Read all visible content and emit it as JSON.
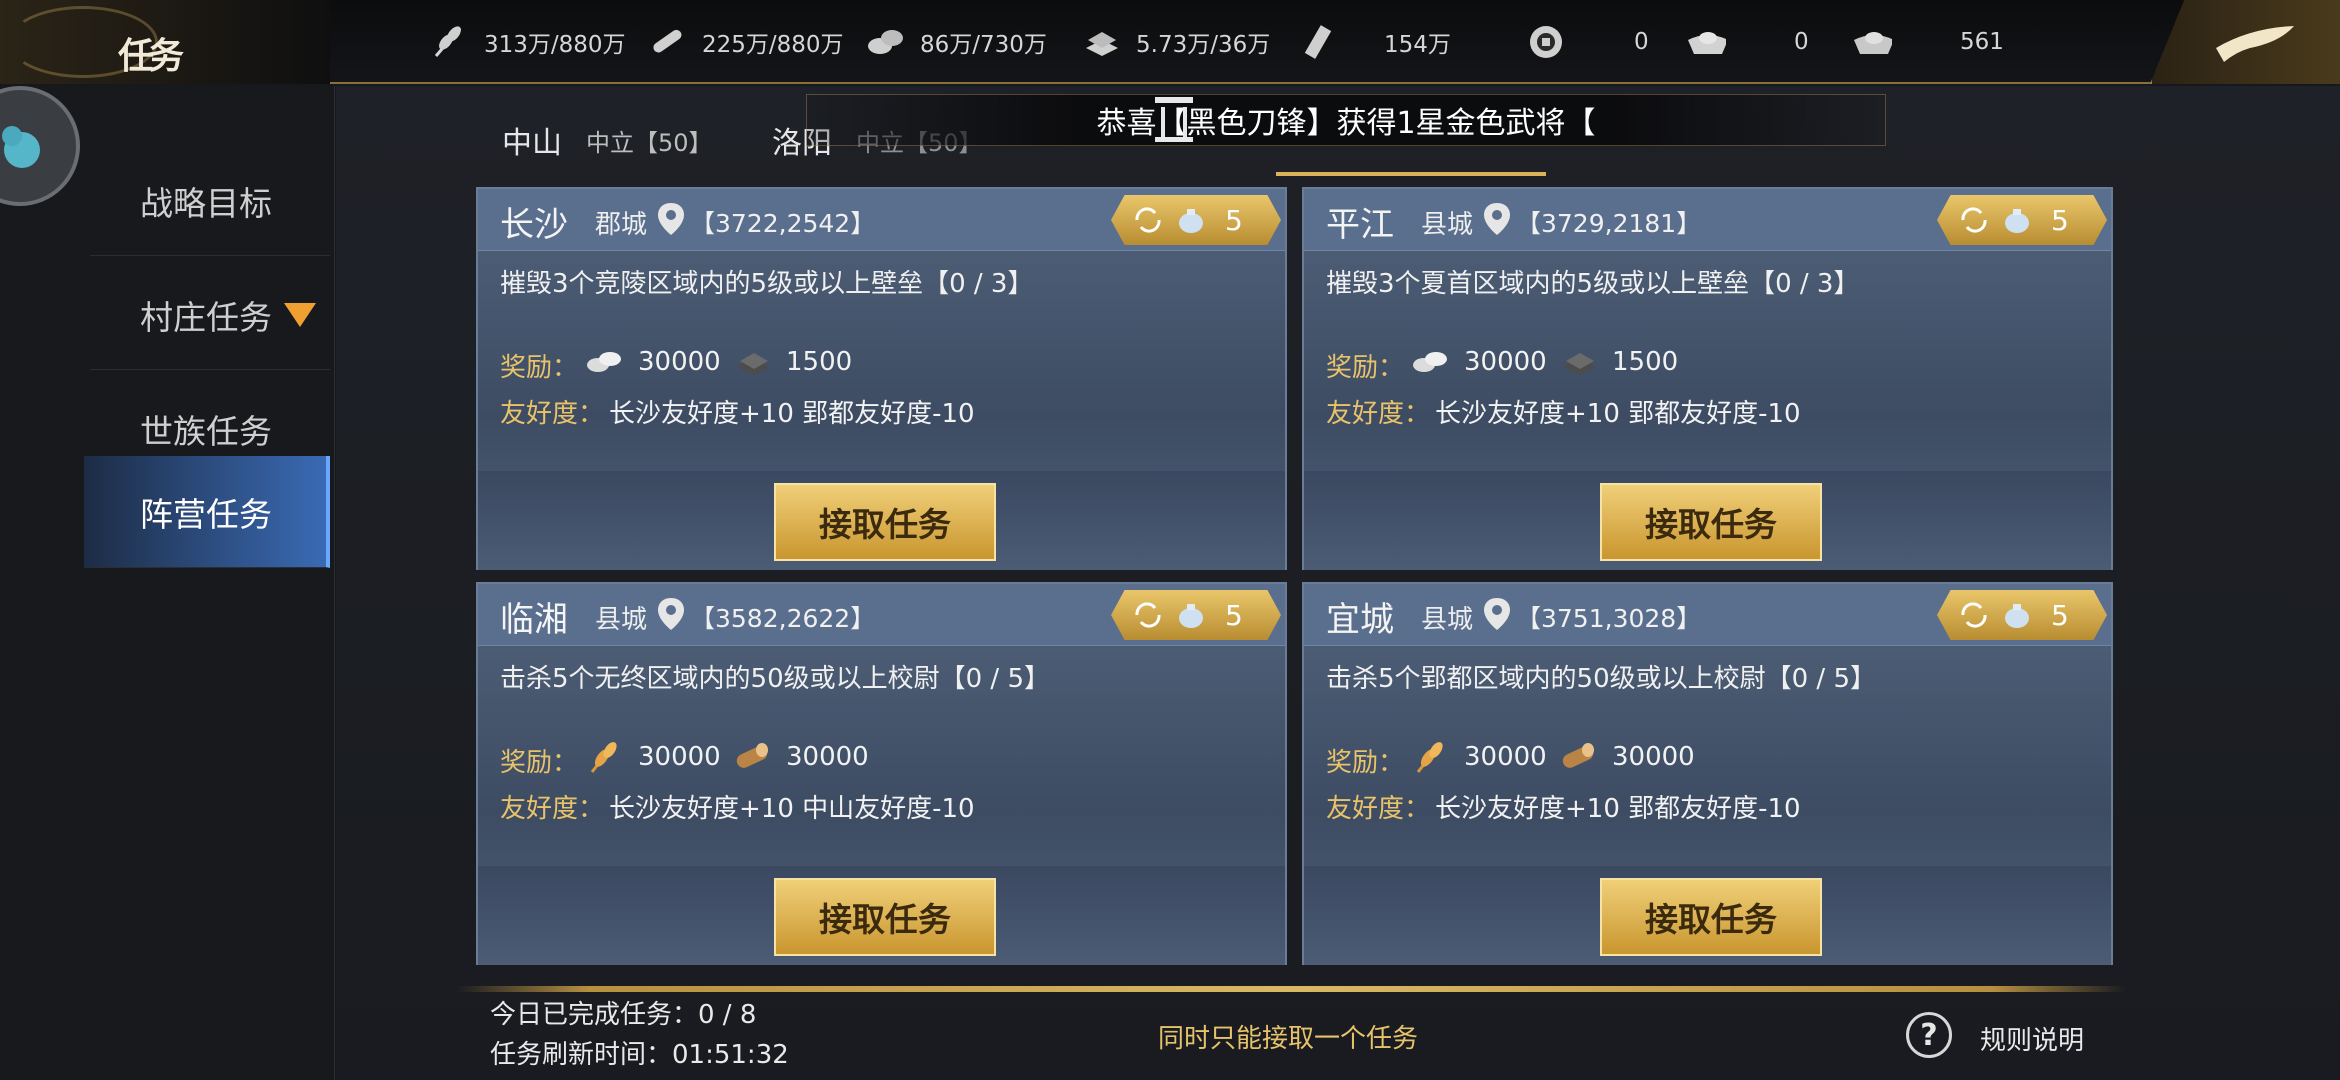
{
  "header": {
    "title": "任务",
    "resources": [
      {
        "icon": "wheat-icon",
        "value": "313万/880万"
      },
      {
        "icon": "wood-icon",
        "value": "225万/880万"
      },
      {
        "icon": "stone-icon",
        "value": "86万/730万"
      },
      {
        "icon": "iron-icon",
        "value": "5.73万/36万"
      },
      {
        "icon": "scroll-icon",
        "value": "154万"
      },
      {
        "icon": "coin-icon",
        "value": "0"
      },
      {
        "icon": "gold-ingot-icon",
        "value": "0"
      },
      {
        "icon": "silver-ingot-icon",
        "value": "561"
      }
    ]
  },
  "sidebar": {
    "items": [
      {
        "label": "战略目标"
      },
      {
        "label": "村庄任务"
      },
      {
        "label": "世族任务"
      },
      {
        "label": "阵营任务"
      }
    ]
  },
  "tabs": [
    {
      "name": "中山",
      "status": "中立【50】"
    },
    {
      "name": "洛阳",
      "status": "中立【50】"
    }
  ],
  "notice": "恭喜【黑色刀锋】获得1星金色武将【",
  "cards": [
    {
      "city": "长沙",
      "type": "郡城",
      "coord": "【3722,2542】",
      "refresh_count": "5",
      "desc": "摧毁3个竞陵区域内的5级或以上壁垒【0 / 3】",
      "reward_label": "奖励：",
      "reward1": "30000",
      "reward2": "1500",
      "reward1_icon": "silver-icon",
      "reward2_icon": "iron-ingot-icon",
      "friend_label": "友好度：",
      "friend": "长沙友好度+10  郢都友好度-10",
      "button": "接取任务"
    },
    {
      "city": "平江",
      "type": "县城",
      "coord": "【3729,2181】",
      "refresh_count": "5",
      "desc": "摧毁3个夏首区域内的5级或以上壁垒【0 / 3】",
      "reward_label": "奖励：",
      "reward1": "30000",
      "reward2": "1500",
      "reward1_icon": "silver-icon",
      "reward2_icon": "iron-ingot-icon",
      "friend_label": "友好度：",
      "friend": "长沙友好度+10  郢都友好度-10",
      "button": "接取任务"
    },
    {
      "city": "临湘",
      "type": "县城",
      "coord": "【3582,2622】",
      "refresh_count": "5",
      "desc": "击杀5个无终区域内的50级或以上校尉【0 / 5】",
      "reward_label": "奖励：",
      "reward1": "30000",
      "reward2": "30000",
      "reward1_icon": "wheat-icon",
      "reward2_icon": "log-icon",
      "friend_label": "友好度：",
      "friend": "长沙友好度+10  中山友好度-10",
      "button": "接取任务"
    },
    {
      "city": "宜城",
      "type": "县城",
      "coord": "【3751,3028】",
      "refresh_count": "5",
      "desc": "击杀5个郢都区域内的50级或以上校尉【0 / 5】",
      "reward_label": "奖励：",
      "reward1": "30000",
      "reward2": "30000",
      "reward1_icon": "wheat-icon",
      "reward2_icon": "log-icon",
      "friend_label": "友好度：",
      "friend": "长沙友好度+10  郢都友好度-10",
      "button": "接取任务"
    }
  ],
  "footer": {
    "completed": "今日已完成任务：0 / 8",
    "refresh_time": "任务刷新时间：01:51:32",
    "note": "同时只能接取一个任务",
    "rules": "规则说明"
  }
}
